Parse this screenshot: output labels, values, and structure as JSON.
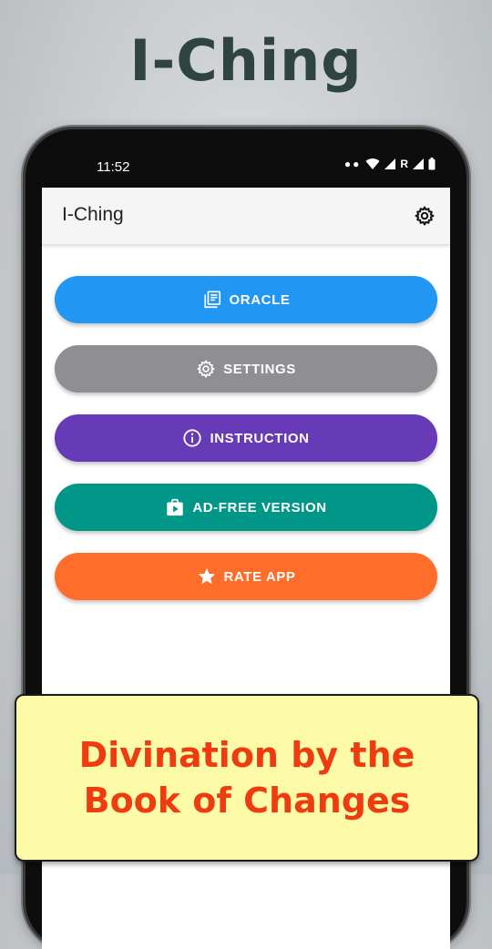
{
  "promo": {
    "title": "I-Ching",
    "caption_line1": "Divination by the",
    "caption_line2": "Book of Changes"
  },
  "status_bar": {
    "time": "11:52",
    "network_label": "R"
  },
  "app_bar": {
    "title": "I-Ching",
    "settings_icon": "gear-icon"
  },
  "menu": {
    "items": [
      {
        "label": "ORACLE",
        "icon": "book-icon",
        "color": "#2196f3"
      },
      {
        "label": "SETTINGS",
        "icon": "gear-icon",
        "color": "#8e8e93"
      },
      {
        "label": "INSTRUCTION",
        "icon": "info-icon",
        "color": "#673ab7"
      },
      {
        "label": "AD-FREE VERSION",
        "icon": "play-store-icon",
        "color": "#009688"
      },
      {
        "label": "RATE APP",
        "icon": "star-icon",
        "color": "#ff6d2a"
      }
    ]
  },
  "colors": {
    "title_text": "#2f4441",
    "caption_text": "#ee3b10",
    "caption_bg": "#fdfba8"
  }
}
